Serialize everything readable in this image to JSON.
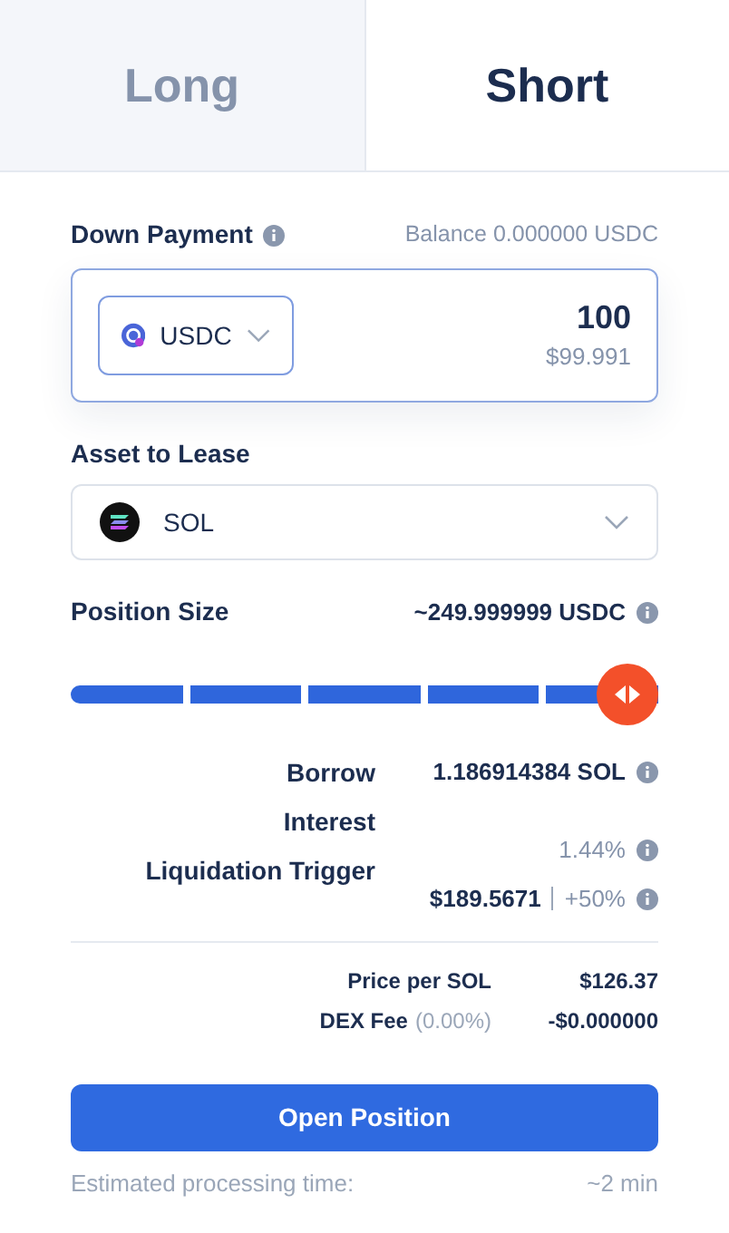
{
  "tabs": [
    {
      "label": "Long",
      "selected": false
    },
    {
      "label": "Short",
      "selected": true
    }
  ],
  "down_payment": {
    "label": "Down Payment",
    "balance": "Balance 0.000000 USDC",
    "currency": "USDC",
    "amount": "100",
    "usd_value": "$99.991"
  },
  "asset_to_lease": {
    "label": "Asset to Lease",
    "asset": "SOL"
  },
  "position_size": {
    "label": "Position Size",
    "value": "~249.999999 USDC",
    "level": 1
  },
  "details": [
    {
      "label": "Borrow",
      "value": "1.186914384 SOL",
      "kind": "strong"
    },
    {
      "label": "Interest",
      "value": "1.44%",
      "kind": "muted"
    },
    {
      "label": "Liquidation Trigger",
      "value": "$189.5671",
      "extra": "+50%",
      "kind": "split"
    }
  ],
  "fees": [
    {
      "label": "Price per SOL",
      "value": "$126.37"
    },
    {
      "label": "DEX Fee",
      "note": "(0.00%)",
      "value": "-$0.000000"
    }
  ],
  "open_button": "Open Position",
  "estimate": {
    "label": "Estimated processing time:",
    "value": "~2 min"
  }
}
